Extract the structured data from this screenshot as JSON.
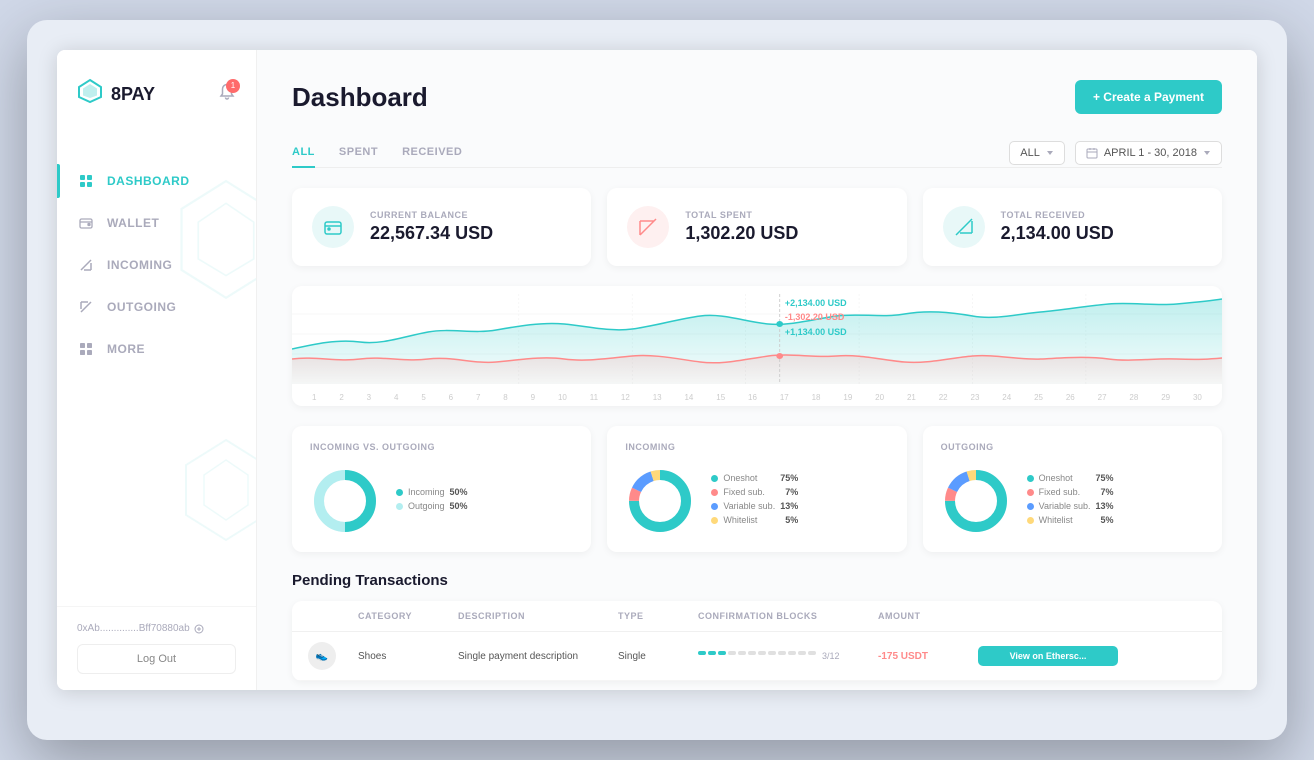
{
  "app": {
    "name": "8PAY",
    "logo_symbol": "◈"
  },
  "notifications": {
    "count": "1"
  },
  "sidebar": {
    "nav_items": [
      {
        "id": "dashboard",
        "label": "DASHBOARD",
        "active": true
      },
      {
        "id": "wallet",
        "label": "WALLET",
        "active": false
      },
      {
        "id": "incoming",
        "label": "INCOMING",
        "active": false
      },
      {
        "id": "outgoing",
        "label": "OUTGOING",
        "active": false
      },
      {
        "id": "more",
        "label": "MORE",
        "active": false
      }
    ],
    "wallet_address": "0xAb..............Bff70880ab",
    "logout_label": "Log Out"
  },
  "header": {
    "title": "Dashboard",
    "create_button": "+ Create a Payment"
  },
  "tabs": [
    {
      "label": "ALL",
      "active": true
    },
    {
      "label": "SPENT",
      "active": false
    },
    {
      "label": "RECEIVED",
      "active": false
    }
  ],
  "filter": {
    "type_label": "ALL",
    "date_label": "APRIL 1 - 30, 2018",
    "calendar_icon": "📅"
  },
  "stats": [
    {
      "id": "balance",
      "label": "CURRENT BALANCE",
      "value": "22,567.34 USD",
      "icon_type": "balance"
    },
    {
      "id": "spent",
      "label": "TOTAL SPENT",
      "value": "1,302.20 USD",
      "icon_type": "spent"
    },
    {
      "id": "received",
      "label": "TOTAL RECEIVED",
      "value": "2,134.00 USD",
      "icon_type": "received"
    }
  ],
  "chart": {
    "tooltip": {
      "line1": "+2,134.00 USD",
      "line2": "-1,302.20 USD",
      "line3": "+1,134.00 USD"
    },
    "x_labels": [
      "1",
      "2",
      "3",
      "4",
      "5",
      "6",
      "7",
      "8",
      "9",
      "10",
      "11",
      "12",
      "13",
      "14",
      "15",
      "16",
      "17",
      "18",
      "19",
      "20",
      "21",
      "22",
      "23",
      "24",
      "25",
      "26",
      "27",
      "28",
      "29",
      "30"
    ]
  },
  "donuts": [
    {
      "id": "incoming-vs-outgoing",
      "title": "INCOMING VS. OUTGOING",
      "segments": [
        {
          "label": "Incoming",
          "pct": "50%",
          "color": "#2ecac8",
          "value": 50
        },
        {
          "label": "Outgoing",
          "pct": "50%",
          "color": "#b3eef0",
          "value": 50
        }
      ]
    },
    {
      "id": "incoming",
      "title": "INCOMING",
      "segments": [
        {
          "label": "Oneshot",
          "pct": "75%",
          "color": "#2ecac8",
          "value": 75
        },
        {
          "label": "Fixed sub.",
          "pct": "7%",
          "color": "#ff8a8a",
          "value": 7
        },
        {
          "label": "Variable sub.",
          "pct": "13%",
          "color": "#5b9cff",
          "value": 13
        },
        {
          "label": "Whitelist",
          "pct": "5%",
          "color": "#ffd97a",
          "value": 5
        }
      ]
    },
    {
      "id": "outgoing",
      "title": "OUTGOING",
      "segments": [
        {
          "label": "Oneshot",
          "pct": "75%",
          "color": "#2ecac8",
          "value": 75
        },
        {
          "label": "Fixed sub.",
          "pct": "7%",
          "color": "#ff8a8a",
          "value": 7
        },
        {
          "label": "Variable sub.",
          "pct": "13%",
          "color": "#5b9cff",
          "value": 13
        },
        {
          "label": "Whitelist",
          "pct": "5%",
          "color": "#ffd97a",
          "value": 5
        }
      ]
    }
  ],
  "pending_transactions": {
    "section_title": "Pending Transactions",
    "columns": [
      "",
      "Category",
      "Description",
      "Type",
      "Confirmation Blocks",
      "Amount",
      ""
    ],
    "rows": [
      {
        "avatar": "👟",
        "category": "Shoes",
        "description": "Single payment description",
        "type": "Single",
        "confirmations": 3,
        "total_confirmations": 12,
        "amount": "-175 USDT",
        "action": "View on Ethersc..."
      }
    ]
  }
}
